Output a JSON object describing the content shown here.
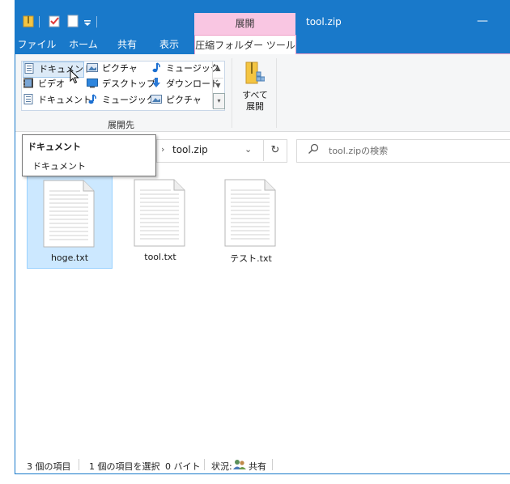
{
  "titlebar": {
    "context_tab_title": "展開",
    "window_title": "tool.zip",
    "minimize_glyph": "—"
  },
  "tabs": [
    {
      "label": "ファイル"
    },
    {
      "label": "ホーム"
    },
    {
      "label": "共有"
    },
    {
      "label": "表示"
    },
    {
      "label": "圧縮フォルダー ツール"
    }
  ],
  "ribbon": {
    "gallery_items": [
      {
        "label": "ドキュメント",
        "icon": "document-icon"
      },
      {
        "label": "ピクチャ",
        "icon": "pictures-icon"
      },
      {
        "label": "ミュージック",
        "icon": "music-icon"
      },
      {
        "label": "ビデオ",
        "icon": "video-icon"
      },
      {
        "label": "デスクトップ",
        "icon": "desktop-icon"
      },
      {
        "label": "ダウンロード",
        "icon": "download-icon"
      },
      {
        "label": "ドキュメント",
        "icon": "document-icon"
      },
      {
        "label": "ミュージック",
        "icon": "music-icon"
      },
      {
        "label": "ピクチャ",
        "icon": "pictures-icon"
      }
    ],
    "group_label": "展開先",
    "extract_all_line1": "すべて",
    "extract_all_line2": "展開"
  },
  "address": {
    "path": "tool.zip",
    "search_placeholder": "tool.zipの検索"
  },
  "tooltip": {
    "title": "ドキュメント",
    "body": "ドキュメント"
  },
  "files": [
    {
      "name": "hoge.txt",
      "selected": true
    },
    {
      "name": "tool.txt",
      "selected": false
    },
    {
      "name": "テスト.txt",
      "selected": false
    }
  ],
  "status": {
    "count": "3 個の項目",
    "selected": "1 個の項目を選択",
    "size": "0 バイト",
    "state_label": "状況:",
    "state_value": "共有"
  },
  "colors": {
    "accent": "#1979ca",
    "context_tab": "#f9c6e2",
    "selection": "#cce8ff"
  }
}
